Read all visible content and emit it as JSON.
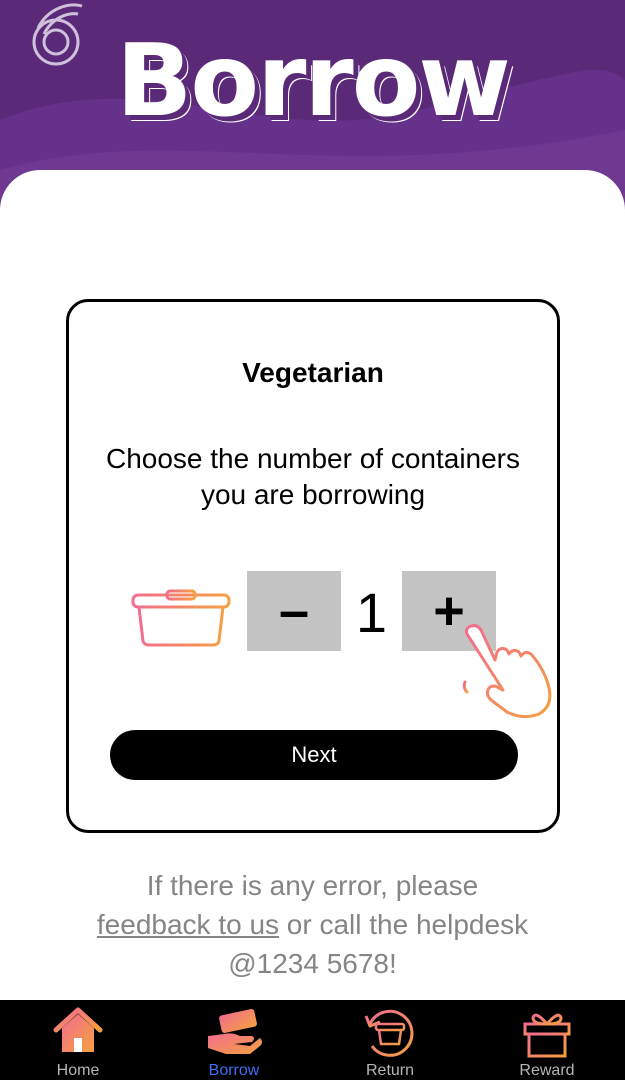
{
  "header": {
    "title": "Borrow"
  },
  "card": {
    "title": "Vegetarian",
    "instruction_line1": "Choose the number of containers",
    "instruction_line2": "you are borrowing",
    "quantity": "1",
    "minus_label": "–",
    "plus_label": "+",
    "next_label": "Next"
  },
  "help": {
    "line1": "If there is any error, please",
    "link": "feedback to us",
    "line2_rest": " or call the helpdesk",
    "line3": "@1234 5678!"
  },
  "tabbar": {
    "active": "Borrow",
    "tabs": [
      {
        "label": "Home",
        "icon": "home-icon"
      },
      {
        "label": "Borrow",
        "icon": "borrow-icon"
      },
      {
        "label": "Return",
        "icon": "return-icon"
      },
      {
        "label": "Reward",
        "icon": "reward-icon"
      }
    ]
  },
  "colors": {
    "header_bg": "#5a2a78",
    "qty_button_bg": "#c4c4c4",
    "active_tab": "#3d6ef5",
    "icon_gradient_start": "#f26d8f",
    "icon_gradient_end": "#f5a040"
  }
}
